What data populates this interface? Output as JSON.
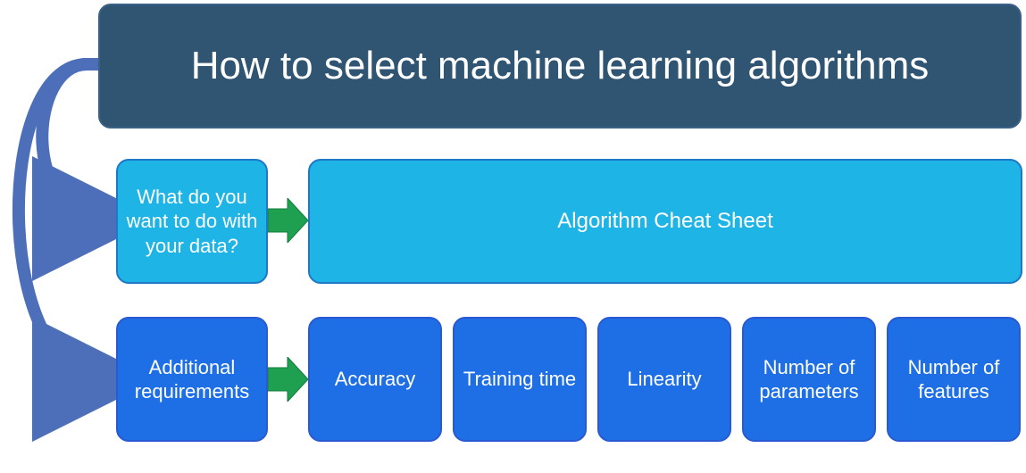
{
  "title": "How to select machine learning algorithms",
  "question": "What do you want to do with your data?",
  "cheat": "Algorithm Cheat Sheet",
  "req": "Additional requirements",
  "metrics": {
    "m1": "Accuracy",
    "m2": "Training time",
    "m3": "Linearity",
    "m4": "Number of parameters",
    "m5": "Number of features"
  },
  "colors": {
    "titleFill": "#2f5573",
    "lightBlue": "#1eb4e6",
    "blue": "#1e6ee6",
    "arrowGreen": "#1ea050",
    "curveBlue": "#4d6fba"
  }
}
